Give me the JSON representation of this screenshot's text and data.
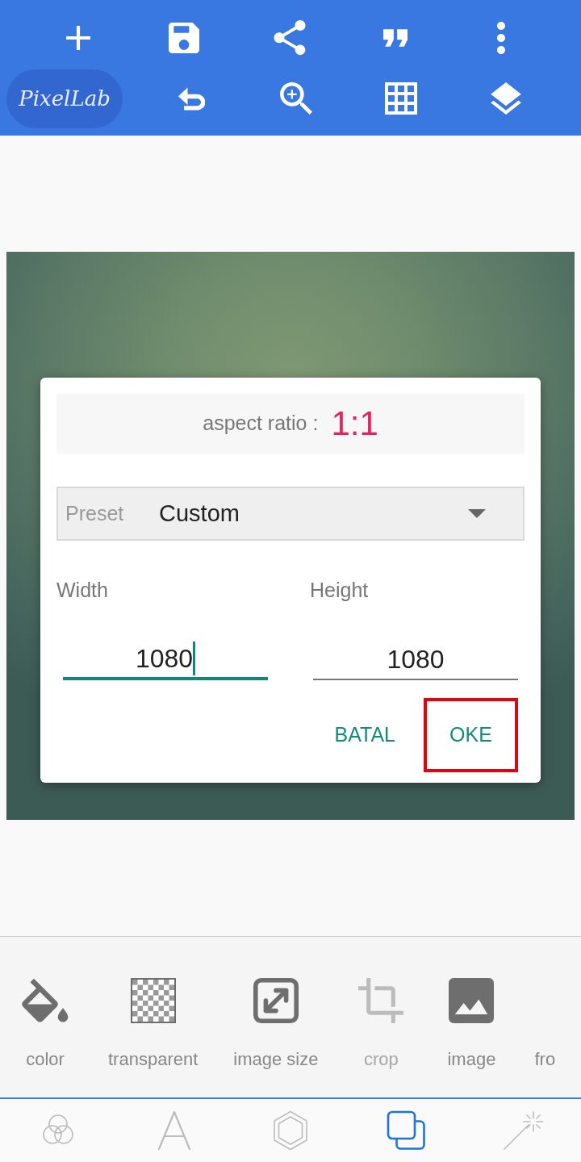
{
  "toolbar": {
    "logo": "PixelLab"
  },
  "dialog": {
    "aspect_label": "aspect ratio :",
    "aspect_value": "1:1",
    "preset": {
      "label": "Preset",
      "value": "Custom"
    },
    "fields": [
      {
        "label": "Width",
        "value": "1080",
        "focused": true
      },
      {
        "label": "Height",
        "value": "1080",
        "focused": false
      }
    ],
    "buttons": [
      {
        "label": "BATAL",
        "highlighted": false
      },
      {
        "label": "OKE",
        "highlighted": true
      }
    ]
  },
  "tools": [
    {
      "label": "color",
      "disabled": false
    },
    {
      "label": "transparent",
      "disabled": false
    },
    {
      "label": "image size",
      "disabled": false
    },
    {
      "label": "crop",
      "disabled": true
    },
    {
      "label": "image",
      "disabled": false
    },
    {
      "label": "fro",
      "disabled": false
    }
  ],
  "bottom_nav": [
    {
      "selected": false
    },
    {
      "selected": false
    },
    {
      "selected": false
    },
    {
      "selected": true
    },
    {
      "selected": false
    }
  ]
}
